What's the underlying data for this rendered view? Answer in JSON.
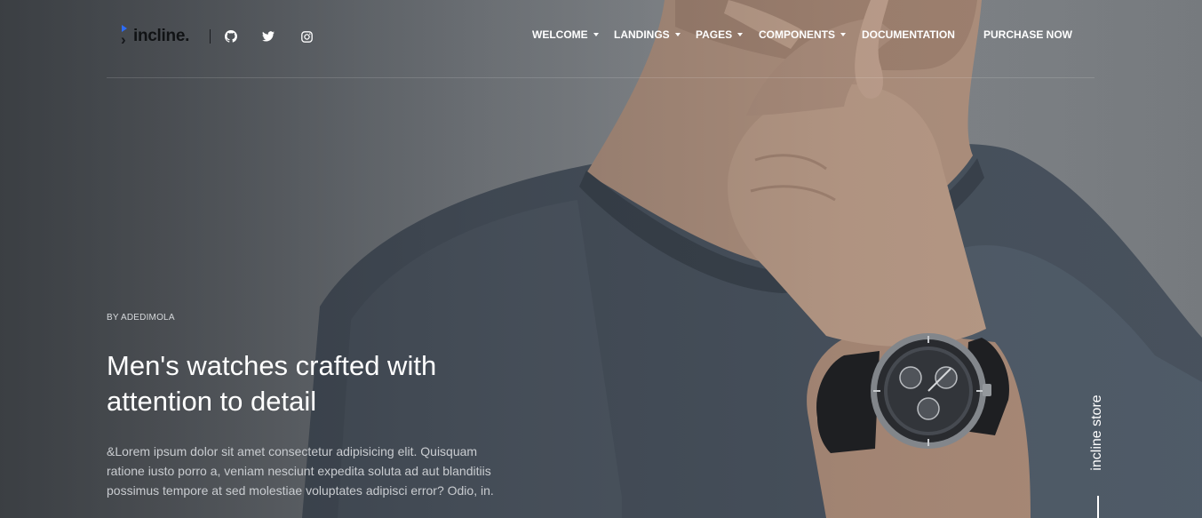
{
  "brand": {
    "name": "incline."
  },
  "social": [
    {
      "icon": "github-icon"
    },
    {
      "icon": "twitter-icon"
    },
    {
      "icon": "instagram-icon"
    }
  ],
  "nav": {
    "items": [
      {
        "label": "WELCOME",
        "has_dropdown": true
      },
      {
        "label": "LANDINGS",
        "has_dropdown": true
      },
      {
        "label": "PAGES",
        "has_dropdown": true
      },
      {
        "label": "COMPONENTS",
        "has_dropdown": true
      },
      {
        "label": "DOCUMENTATION",
        "has_dropdown": false
      },
      {
        "label": "PURCHASE NOW",
        "has_dropdown": false
      }
    ]
  },
  "hero": {
    "eyebrow": "BY ADEDIMOLA",
    "headline": "Men's watches crafted with attention to detail",
    "body": "&Lorem ipsum dolor sit amet consectetur adipisicing elit. Quisquam ratione iusto porro a, veniam nesciunt expedita soluta ad aut blanditiis possimus tempore at sed molestiae voluptates adipisci error? Odio, in.",
    "side_label": "incline store"
  },
  "colors": {
    "accent": "#2d6cf6",
    "nav_text": "#ffffff",
    "brand_text": "#111315"
  }
}
